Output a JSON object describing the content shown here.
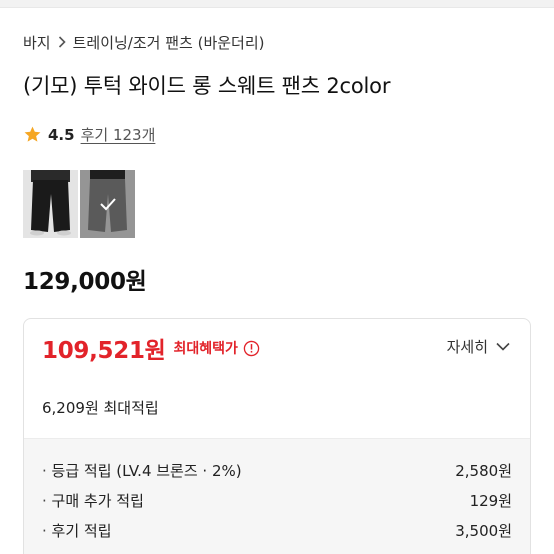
{
  "breadcrumb": {
    "category": "바지",
    "subcategory": "트레이닝/조거 팬츠 (바운더리)"
  },
  "product": {
    "title": "(기모) 투턱 와이드 롱 스웨트 팬츠 2color",
    "rating": "4.5",
    "reviews": "후기 123개",
    "price": "129,000원"
  },
  "thumbnails": [
    {
      "name": "black",
      "color": "#1a1a1a"
    },
    {
      "name": "gray",
      "color": "#8a8a8a",
      "selected": true
    }
  ],
  "benefit": {
    "best_price": "109,521원",
    "best_label": "최대혜택가",
    "detail_label": "자세히",
    "accumulation": "6,209원 최대적립",
    "accent_color": "#e2232a",
    "rows": [
      {
        "label": "등급 적립 (LV.4 브론즈 · 2%)",
        "value": "2,580원"
      },
      {
        "label": "구매 추가 적립",
        "value": "129원"
      },
      {
        "label": "후기 적립",
        "value": "3,500원"
      }
    ]
  }
}
